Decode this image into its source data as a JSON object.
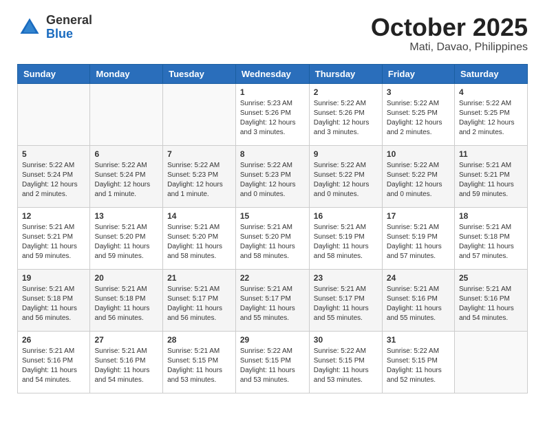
{
  "header": {
    "logo_general": "General",
    "logo_blue": "Blue",
    "month": "October 2025",
    "location": "Mati, Davao, Philippines"
  },
  "weekdays": [
    "Sunday",
    "Monday",
    "Tuesday",
    "Wednesday",
    "Thursday",
    "Friday",
    "Saturday"
  ],
  "weeks": [
    [
      {
        "day": "",
        "info": ""
      },
      {
        "day": "",
        "info": ""
      },
      {
        "day": "",
        "info": ""
      },
      {
        "day": "1",
        "info": "Sunrise: 5:23 AM\nSunset: 5:26 PM\nDaylight: 12 hours and 3 minutes."
      },
      {
        "day": "2",
        "info": "Sunrise: 5:22 AM\nSunset: 5:26 PM\nDaylight: 12 hours and 3 minutes."
      },
      {
        "day": "3",
        "info": "Sunrise: 5:22 AM\nSunset: 5:25 PM\nDaylight: 12 hours and 2 minutes."
      },
      {
        "day": "4",
        "info": "Sunrise: 5:22 AM\nSunset: 5:25 PM\nDaylight: 12 hours and 2 minutes."
      }
    ],
    [
      {
        "day": "5",
        "info": "Sunrise: 5:22 AM\nSunset: 5:24 PM\nDaylight: 12 hours and 2 minutes."
      },
      {
        "day": "6",
        "info": "Sunrise: 5:22 AM\nSunset: 5:24 PM\nDaylight: 12 hours and 1 minute."
      },
      {
        "day": "7",
        "info": "Sunrise: 5:22 AM\nSunset: 5:23 PM\nDaylight: 12 hours and 1 minute."
      },
      {
        "day": "8",
        "info": "Sunrise: 5:22 AM\nSunset: 5:23 PM\nDaylight: 12 hours and 0 minutes."
      },
      {
        "day": "9",
        "info": "Sunrise: 5:22 AM\nSunset: 5:22 PM\nDaylight: 12 hours and 0 minutes."
      },
      {
        "day": "10",
        "info": "Sunrise: 5:22 AM\nSunset: 5:22 PM\nDaylight: 12 hours and 0 minutes."
      },
      {
        "day": "11",
        "info": "Sunrise: 5:21 AM\nSunset: 5:21 PM\nDaylight: 11 hours and 59 minutes."
      }
    ],
    [
      {
        "day": "12",
        "info": "Sunrise: 5:21 AM\nSunset: 5:21 PM\nDaylight: 11 hours and 59 minutes."
      },
      {
        "day": "13",
        "info": "Sunrise: 5:21 AM\nSunset: 5:20 PM\nDaylight: 11 hours and 59 minutes."
      },
      {
        "day": "14",
        "info": "Sunrise: 5:21 AM\nSunset: 5:20 PM\nDaylight: 11 hours and 58 minutes."
      },
      {
        "day": "15",
        "info": "Sunrise: 5:21 AM\nSunset: 5:20 PM\nDaylight: 11 hours and 58 minutes."
      },
      {
        "day": "16",
        "info": "Sunrise: 5:21 AM\nSunset: 5:19 PM\nDaylight: 11 hours and 58 minutes."
      },
      {
        "day": "17",
        "info": "Sunrise: 5:21 AM\nSunset: 5:19 PM\nDaylight: 11 hours and 57 minutes."
      },
      {
        "day": "18",
        "info": "Sunrise: 5:21 AM\nSunset: 5:18 PM\nDaylight: 11 hours and 57 minutes."
      }
    ],
    [
      {
        "day": "19",
        "info": "Sunrise: 5:21 AM\nSunset: 5:18 PM\nDaylight: 11 hours and 56 minutes."
      },
      {
        "day": "20",
        "info": "Sunrise: 5:21 AM\nSunset: 5:18 PM\nDaylight: 11 hours and 56 minutes."
      },
      {
        "day": "21",
        "info": "Sunrise: 5:21 AM\nSunset: 5:17 PM\nDaylight: 11 hours and 56 minutes."
      },
      {
        "day": "22",
        "info": "Sunrise: 5:21 AM\nSunset: 5:17 PM\nDaylight: 11 hours and 55 minutes."
      },
      {
        "day": "23",
        "info": "Sunrise: 5:21 AM\nSunset: 5:17 PM\nDaylight: 11 hours and 55 minutes."
      },
      {
        "day": "24",
        "info": "Sunrise: 5:21 AM\nSunset: 5:16 PM\nDaylight: 11 hours and 55 minutes."
      },
      {
        "day": "25",
        "info": "Sunrise: 5:21 AM\nSunset: 5:16 PM\nDaylight: 11 hours and 54 minutes."
      }
    ],
    [
      {
        "day": "26",
        "info": "Sunrise: 5:21 AM\nSunset: 5:16 PM\nDaylight: 11 hours and 54 minutes."
      },
      {
        "day": "27",
        "info": "Sunrise: 5:21 AM\nSunset: 5:16 PM\nDaylight: 11 hours and 54 minutes."
      },
      {
        "day": "28",
        "info": "Sunrise: 5:21 AM\nSunset: 5:15 PM\nDaylight: 11 hours and 53 minutes."
      },
      {
        "day": "29",
        "info": "Sunrise: 5:22 AM\nSunset: 5:15 PM\nDaylight: 11 hours and 53 minutes."
      },
      {
        "day": "30",
        "info": "Sunrise: 5:22 AM\nSunset: 5:15 PM\nDaylight: 11 hours and 53 minutes."
      },
      {
        "day": "31",
        "info": "Sunrise: 5:22 AM\nSunset: 5:15 PM\nDaylight: 11 hours and 52 minutes."
      },
      {
        "day": "",
        "info": ""
      }
    ]
  ]
}
